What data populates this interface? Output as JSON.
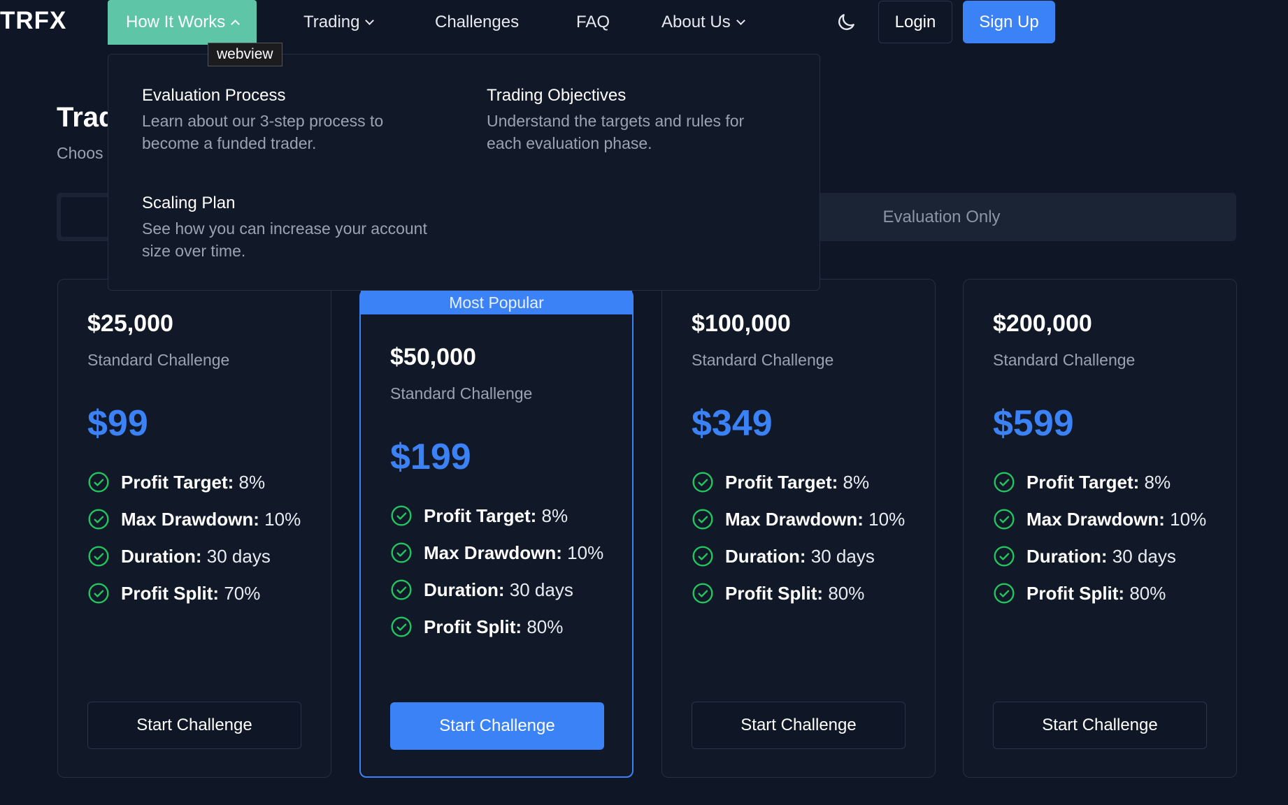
{
  "brand": {
    "logo": "TRFX"
  },
  "nav": {
    "how_it_works": "How It Works",
    "trading": "Trading",
    "challenges": "Challenges",
    "faq": "FAQ",
    "about_us": "About Us",
    "login": "Login",
    "sign_up": "Sign Up"
  },
  "tooltip": "webview",
  "dropdown": {
    "items": [
      {
        "title": "Evaluation Process",
        "desc": "Learn about our 3-step process to become a funded trader."
      },
      {
        "title": "Trading Objectives",
        "desc": "Understand the targets and rules for each evaluation phase."
      },
      {
        "title": "Scaling Plan",
        "desc": "See how you can increase your account size over time."
      }
    ]
  },
  "page": {
    "title_visible": "Trad",
    "subtitle_visible": "Choos"
  },
  "tabs": {
    "right_label": "Evaluation Only"
  },
  "plans": [
    {
      "amount": "$25,000",
      "type": "Standard Challenge",
      "price": "$99",
      "features": [
        {
          "label": "Profit Target:",
          "value": "8%"
        },
        {
          "label": "Max Drawdown:",
          "value": "10%"
        },
        {
          "label": "Duration:",
          "value": "30 days"
        },
        {
          "label": "Profit Split:",
          "value": "70%"
        }
      ],
      "cta": "Start Challenge"
    },
    {
      "badge": "Most Popular",
      "amount": "$50,000",
      "type": "Standard Challenge",
      "price": "$199",
      "features": [
        {
          "label": "Profit Target:",
          "value": "8%"
        },
        {
          "label": "Max Drawdown:",
          "value": "10%"
        },
        {
          "label": "Duration:",
          "value": "30 days"
        },
        {
          "label": "Profit Split:",
          "value": "80%"
        }
      ],
      "cta": "Start Challenge"
    },
    {
      "amount": "$100,000",
      "type": "Standard Challenge",
      "price": "$349",
      "features": [
        {
          "label": "Profit Target:",
          "value": "8%"
        },
        {
          "label": "Max Drawdown:",
          "value": "10%"
        },
        {
          "label": "Duration:",
          "value": "30 days"
        },
        {
          "label": "Profit Split:",
          "value": "80%"
        }
      ],
      "cta": "Start Challenge"
    },
    {
      "amount": "$200,000",
      "type": "Standard Challenge",
      "price": "$599",
      "features": [
        {
          "label": "Profit Target:",
          "value": "8%"
        },
        {
          "label": "Max Drawdown:",
          "value": "10%"
        },
        {
          "label": "Duration:",
          "value": "30 days"
        },
        {
          "label": "Profit Split:",
          "value": "80%"
        }
      ],
      "cta": "Start Challenge"
    }
  ],
  "icons": {
    "theme_toggle": "moon-icon",
    "feature_check": "check-circle-icon",
    "nav_caret": "chevron-down-icon",
    "nav_caret_open": "chevron-up-icon"
  },
  "colors": {
    "background": "#0f1626",
    "card": "#111827",
    "accent": "#3b82f6",
    "active_nav": "#5ec6a6",
    "check": "#22c55e"
  }
}
